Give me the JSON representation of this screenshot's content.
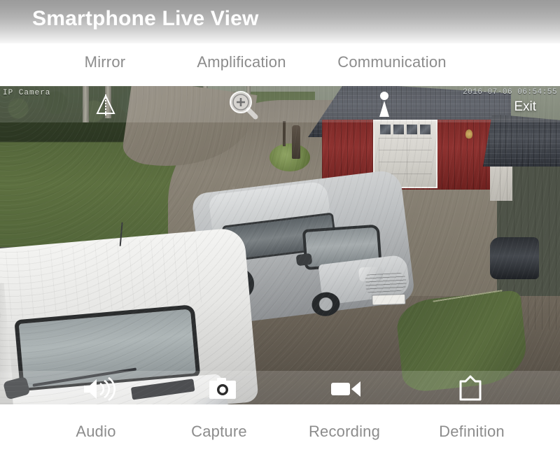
{
  "header": {
    "title": "Smartphone Live View"
  },
  "top_controls": [
    {
      "label": "Mirror",
      "icon": "mirror-flip-icon"
    },
    {
      "label": "Amplification",
      "icon": "magnifier-plus-icon"
    },
    {
      "label": "Communication",
      "icon": "microphone-icon"
    }
  ],
  "bottom_controls": [
    {
      "label": "Audio",
      "icon": "speaker-sound-icon"
    },
    {
      "label": "Capture",
      "icon": "camera-icon"
    },
    {
      "label": "Recording",
      "icon": "video-camera-icon"
    },
    {
      "label": "Definition",
      "icon": "square-up-arrow-icon"
    }
  ],
  "video": {
    "channel_label": "IP Camera",
    "timestamp": "2016-07-06 06:54:55",
    "exit_label": "Exit",
    "scene_description": "Outdoor driveway surveillance view: white van and silver station wagon parked on gravel in front of a red garage with a white door"
  },
  "colors": {
    "header_gradient_top": "#9b9b9b",
    "header_gradient_bottom": "#f8f8f8",
    "header_title_text": "#ffffff",
    "label_text": "#8c8c8c",
    "page_background": "#ffffff",
    "osd_text": "#ffffff"
  }
}
